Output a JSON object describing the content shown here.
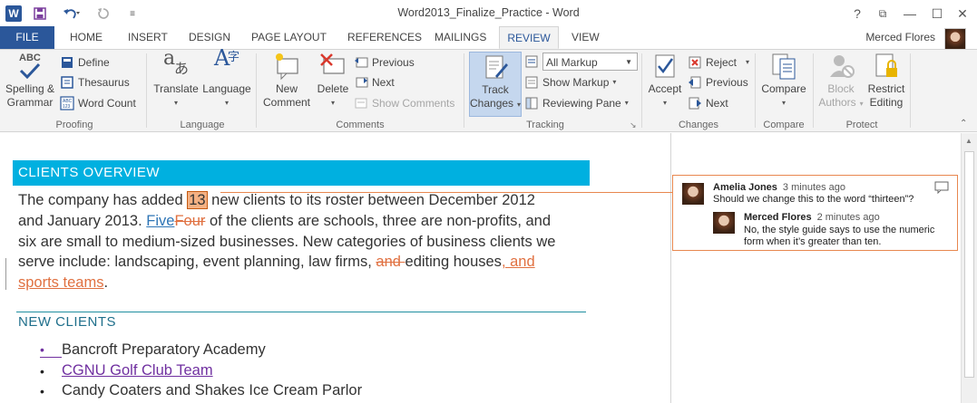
{
  "window": {
    "title": "Word2013_Finalize_Practice - Word",
    "logo_letter": "W",
    "help": "?",
    "restore_ribbon": "⧉",
    "minimize": "—",
    "maximize": "☐",
    "close": "✕"
  },
  "qat": {
    "save_icon": "save-icon",
    "undo_icon": "undo-icon",
    "redo_icon": "redo-icon",
    "customize_icon": "customize-qat-icon"
  },
  "tabs": [
    "FILE",
    "HOME",
    "INSERT",
    "DESIGN",
    "PAGE LAYOUT",
    "REFERENCES",
    "MAILINGS",
    "REVIEW",
    "VIEW"
  ],
  "active_tab": "REVIEW",
  "user": {
    "name": "Merced Flores"
  },
  "ribbon": {
    "proofing": {
      "label": "Proofing",
      "spelling": "Spelling &",
      "spelling2": "Grammar",
      "abc": "ABC",
      "define": "Define",
      "thesaurus": "Thesaurus",
      "word_count": "Word Count"
    },
    "language": {
      "label": "Language",
      "translate": "Translate",
      "language": "Language"
    },
    "comments": {
      "label": "Comments",
      "new_comment": "New",
      "new_comment2": "Comment",
      "delete": "Delete",
      "previous": "Previous",
      "next": "Next",
      "show_comments": "Show Comments"
    },
    "tracking": {
      "label": "Tracking",
      "track_changes": "Track",
      "track_changes2": "Changes",
      "markup_select": "All Markup",
      "show_markup": "Show Markup",
      "reviewing_pane": "Reviewing Pane"
    },
    "changes": {
      "label": "Changes",
      "accept": "Accept",
      "reject": "Reject",
      "previous": "Previous",
      "next": "Next"
    },
    "compare": {
      "label": "Compare",
      "compare": "Compare"
    },
    "protect": {
      "label": "Protect",
      "block_authors": "Block",
      "block_authors2": "Authors",
      "restrict_editing": "Restrict",
      "restrict_editing2": "Editing"
    }
  },
  "document": {
    "heading1": "CLIENTS OVERVIEW",
    "p1_a": "The company has added ",
    "p1_num": "13",
    "p1_b": " new clients to its roster between December 2012",
    "p1_c": "and January 2013. ",
    "p1_ins": "Five",
    "p1_del": "Four",
    "p1_d": " of the clients are schools, three are non-profits, and",
    "p1_e": "six are small to medium-sized businesses. New categories of business clients we",
    "p1_f": "serve include: landscaping, event planning, law firms, ",
    "p1_del2": "and ",
    "p1_g": "editing houses",
    "p1_ins2": ", and",
    "p1_ins3": "sports teams",
    "p1_h": ".",
    "heading2": "NEW CLIENTS",
    "list": [
      "Bancroft Preparatory Academy",
      "CGNU Golf Club Team",
      "Candy Coaters and Shakes Ice Cream Parlor"
    ]
  },
  "comments": [
    {
      "author": "Amelia Jones",
      "time": "3 minutes ago",
      "text": "Should we change this to the word “thirteen”?"
    },
    {
      "author": "Merced Flores",
      "time": "2 minutes ago",
      "text_line1": "No, the style guide says to use the numeric",
      "text_line2": "form when it’s greater than ten."
    }
  ],
  "colors": {
    "word_blue": "#2b579a",
    "heading_bar": "#00b0e0",
    "comment_orange": "#e8874f",
    "insert_blue": "#2e75b6"
  }
}
